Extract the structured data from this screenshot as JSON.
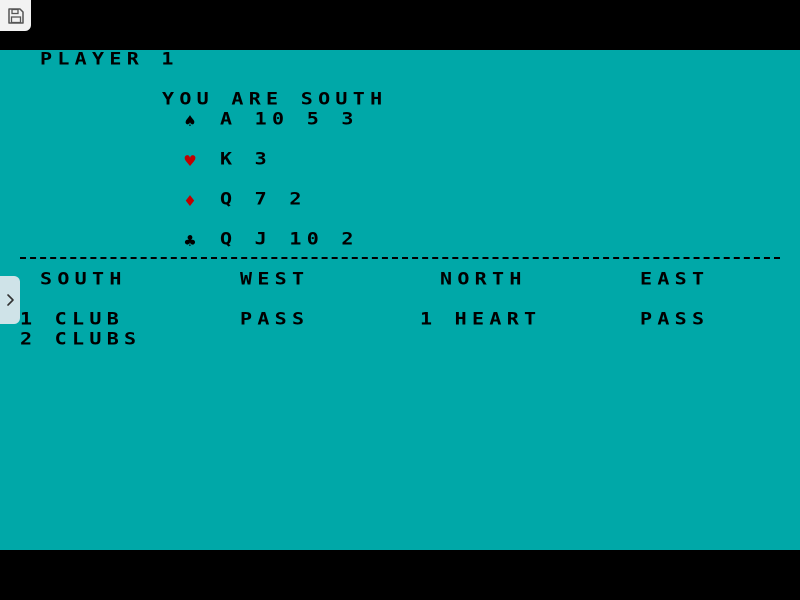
{
  "colors": {
    "background": "#00A8A8",
    "border": "#000000",
    "text": "#000000",
    "red_suit": "#C00000"
  },
  "toolbar": {
    "save_icon": "floppy-disk-icon",
    "side_panel_icon": "chevron-right-icon"
  },
  "header": {
    "player": "PLAYER 1",
    "seat": "YOU ARE SOUTH"
  },
  "hand": [
    {
      "suit": "spades",
      "symbol": "♠",
      "color": "#000000",
      "cards": "A 10 5 3"
    },
    {
      "suit": "hearts",
      "symbol": "♥",
      "color": "#C00000",
      "cards": "K 3"
    },
    {
      "suit": "diamonds",
      "symbol": "♦",
      "color": "#C00000",
      "cards": "Q 7 2"
    },
    {
      "suit": "clubs",
      "symbol": "♣",
      "color": "#000000",
      "cards": "Q J 10 2"
    }
  ],
  "bidding": {
    "columns": [
      "SOUTH",
      "WEST",
      "NORTH",
      "EAST"
    ],
    "rows": [
      [
        "1 CLUB",
        "PASS",
        "1 HEART",
        "PASS"
      ],
      [
        "2 CLUBS",
        "",
        "",
        ""
      ]
    ]
  }
}
